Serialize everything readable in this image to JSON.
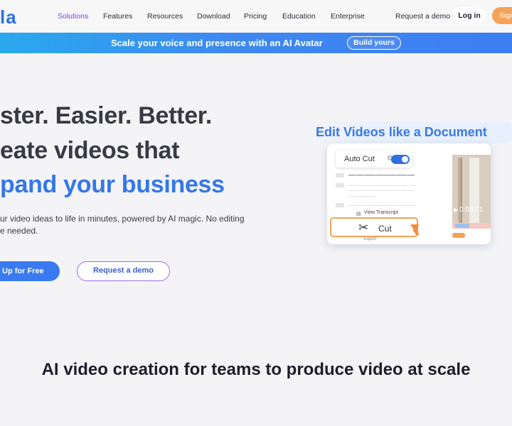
{
  "nav": {
    "logo": "la",
    "items": [
      "Solutions",
      "Features",
      "Resources",
      "Download",
      "Pricing",
      "Education",
      "Enterprise",
      "Request a demo"
    ],
    "active_item": "Solutions",
    "login": "Log in",
    "signup": "Sign",
    "active_color": "#7a3ff2"
  },
  "banner": {
    "text": "Scale your voice and presence with an AI Avatar",
    "button": "Build yours"
  },
  "hero": {
    "line1": "ster. Easier. Better.",
    "line2": "eate videos that",
    "line3": "pand your business",
    "subtitle_line1": "ur video ideas to life in minutes, powered by AI magic. No editing",
    "subtitle_line2": "e needed.",
    "cta_primary": "Up for Free",
    "cta_secondary": "Request a demo",
    "accent_color": "#3577e6"
  },
  "illustration": {
    "title": "Edit Videos like a Document",
    "auto_cut_label": "Auto Cut",
    "auto_cut_enabled": true,
    "view_transcript": "View Transcript",
    "export": "Export",
    "video_time": "0:03 / 1",
    "cut_label": "Cut"
  },
  "section": {
    "title": "AI video creation for teams to produce video at scale"
  }
}
